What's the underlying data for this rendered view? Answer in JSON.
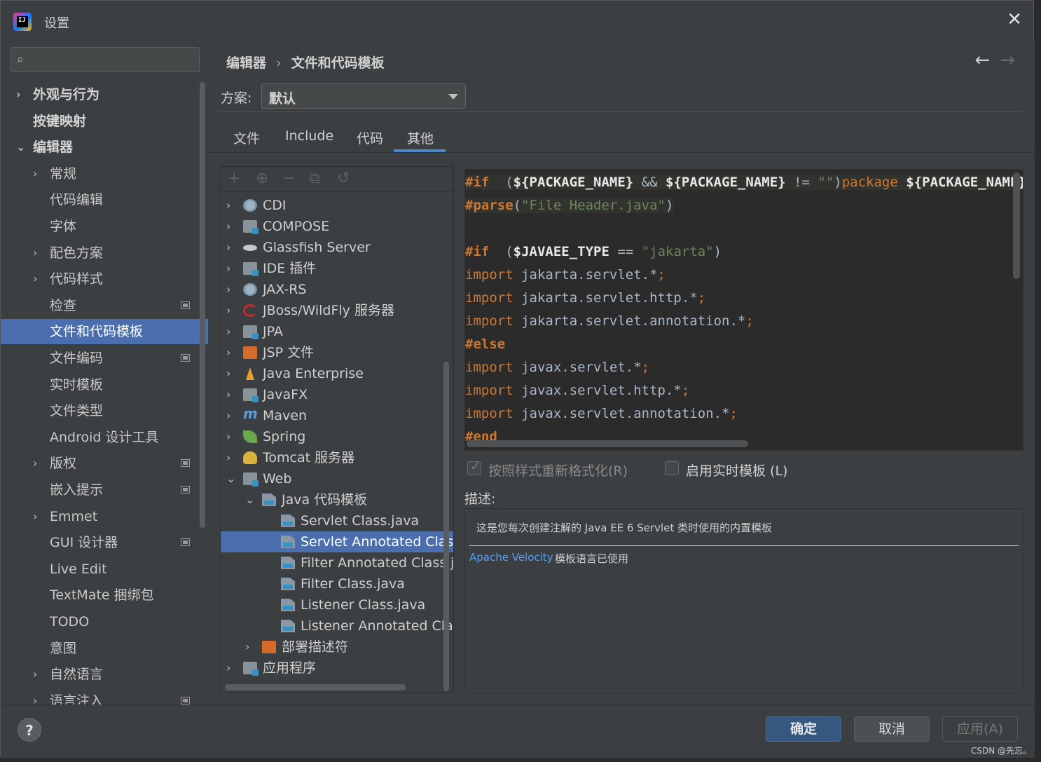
{
  "window": {
    "title": "设置",
    "app_icon": "intellij-icon",
    "close": "✕"
  },
  "search": {
    "placeholder": ""
  },
  "sidebar": {
    "items": [
      {
        "label": "外观与行为",
        "chevron": "›",
        "level": 0,
        "bold": true
      },
      {
        "label": "按键映射",
        "chevron": "",
        "level": 0,
        "bold": true
      },
      {
        "label": "编辑器",
        "chevron": "⌄",
        "level": 0,
        "bold": true
      },
      {
        "label": "常规",
        "chevron": "›",
        "level": 1
      },
      {
        "label": "代码编辑",
        "chevron": "",
        "level": 1
      },
      {
        "label": "字体",
        "chevron": "",
        "level": 1
      },
      {
        "label": "配色方案",
        "chevron": "›",
        "level": 1
      },
      {
        "label": "代码样式",
        "chevron": "›",
        "level": 1
      },
      {
        "label": "检查",
        "chevron": "",
        "level": 1,
        "project": true
      },
      {
        "label": "文件和代码模板",
        "chevron": "",
        "level": 1,
        "selected": true
      },
      {
        "label": "文件编码",
        "chevron": "",
        "level": 1,
        "project": true
      },
      {
        "label": "实时模板",
        "chevron": "",
        "level": 1
      },
      {
        "label": "文件类型",
        "chevron": "",
        "level": 1
      },
      {
        "label": "Android 设计工具",
        "chevron": "",
        "level": 1
      },
      {
        "label": "版权",
        "chevron": "›",
        "level": 1,
        "project": true
      },
      {
        "label": "嵌入提示",
        "chevron": "",
        "level": 1,
        "project": true
      },
      {
        "label": "Emmet",
        "chevron": "›",
        "level": 1
      },
      {
        "label": "GUI 设计器",
        "chevron": "",
        "level": 1,
        "project": true
      },
      {
        "label": "Live Edit",
        "chevron": "",
        "level": 1
      },
      {
        "label": "TextMate 捆绑包",
        "chevron": "",
        "level": 1
      },
      {
        "label": "TODO",
        "chevron": "",
        "level": 1
      },
      {
        "label": "意图",
        "chevron": "",
        "level": 1
      },
      {
        "label": "自然语言",
        "chevron": "›",
        "level": 1
      },
      {
        "label": "语言注入",
        "chevron": "›",
        "level": 1,
        "project": true
      }
    ]
  },
  "breadcrumb": {
    "parent": "编辑器",
    "separator": "›",
    "current": "文件和代码模板"
  },
  "nav": {
    "back": "←",
    "forward": "→"
  },
  "scheme": {
    "label": "方案:",
    "value": "默认"
  },
  "tabs": [
    {
      "label": "文件"
    },
    {
      "label": "Include"
    },
    {
      "label": "代码"
    },
    {
      "label": "其他",
      "active": true
    }
  ],
  "tree_toolbar": {
    "add": "+",
    "add_child": "⊕",
    "remove": "−",
    "copy": "⧉",
    "reset": "↺"
  },
  "tree": [
    {
      "label": "CDI",
      "chevron": "›",
      "level": 0,
      "icon": "cdi-icon",
      "icon_class": "globe"
    },
    {
      "label": "COMPOSE",
      "chevron": "›",
      "level": 0,
      "icon": "folder-icon",
      "icon_class": "folder"
    },
    {
      "label": "Glassfish Server",
      "chevron": "›",
      "level": 0,
      "icon": "glassfish-icon",
      "icon_class": "fish"
    },
    {
      "label": "IDE 插件",
      "chevron": "›",
      "level": 0,
      "icon": "plugin-icon",
      "icon_class": "folder"
    },
    {
      "label": "JAX-RS",
      "chevron": "›",
      "level": 0,
      "icon": "globe-icon",
      "icon_class": "globe"
    },
    {
      "label": "JBoss/WildFly 服务器",
      "chevron": "›",
      "level": 0,
      "icon": "jboss-icon",
      "icon_class": "red"
    },
    {
      "label": "JPA",
      "chevron": "›",
      "level": 0,
      "icon": "jpa-icon",
      "icon_class": "folder"
    },
    {
      "label": "JSP 文件",
      "chevron": "›",
      "level": 0,
      "icon": "jsp-icon",
      "icon_class": "jsp"
    },
    {
      "label": "Java Enterprise",
      "chevron": "›",
      "level": 0,
      "icon": "java-ee-icon",
      "icon_class": "orange"
    },
    {
      "label": "JavaFX",
      "chevron": "›",
      "level": 0,
      "icon": "folder-icon",
      "icon_class": "folder"
    },
    {
      "label": "Maven",
      "chevron": "›",
      "level": 0,
      "icon": "maven-icon",
      "icon_class": "m"
    },
    {
      "label": "Spring",
      "chevron": "›",
      "level": 0,
      "icon": "spring-leaf-icon",
      "icon_class": "leaf"
    },
    {
      "label": "Tomcat 服务器",
      "chevron": "›",
      "level": 0,
      "icon": "tomcat-icon",
      "icon_class": "cat"
    },
    {
      "label": "Web",
      "chevron": "⌄",
      "level": 0,
      "icon": "web-icon",
      "icon_class": "folder"
    },
    {
      "label": "Java 代码模板",
      "chevron": "⌄",
      "level": 1,
      "icon": "file-template-icon",
      "icon_class": "file"
    },
    {
      "label": "Servlet Class.java",
      "chevron": "",
      "level": 2,
      "icon": "file-template-icon",
      "icon_class": "file"
    },
    {
      "label": "Servlet Annotated Class.java",
      "chevron": "",
      "level": 2,
      "icon": "file-template-icon",
      "icon_class": "file",
      "selected": true
    },
    {
      "label": "Filter Annotated Class.java",
      "chevron": "",
      "level": 2,
      "icon": "file-template-icon",
      "icon_class": "file"
    },
    {
      "label": "Filter Class.java",
      "chevron": "",
      "level": 2,
      "icon": "file-template-icon",
      "icon_class": "file"
    },
    {
      "label": "Listener Class.java",
      "chevron": "",
      "level": 2,
      "icon": "file-template-icon",
      "icon_class": "file"
    },
    {
      "label": "Listener Annotated Class.java",
      "chevron": "",
      "level": 2,
      "icon": "file-template-icon",
      "icon_class": "file"
    },
    {
      "label": "部署描述符",
      "chevron": "›",
      "level": 1,
      "icon": "deployment-icon",
      "icon_class": "jsp"
    },
    {
      "label": "应用程序",
      "chevron": "›",
      "level": 0,
      "icon": "application-icon",
      "icon_class": "folder"
    }
  ],
  "code": [
    [
      [
        "dir",
        "#if"
      ],
      [
        "",
        "  ("
      ],
      [
        "var",
        "${PACKAGE_NAME}"
      ],
      [
        "",
        " && "
      ],
      [
        "var",
        "${PACKAGE_NAME}"
      ],
      [
        "",
        " != "
      ],
      [
        "str",
        "\"\""
      ],
      [
        "",
        ")"
      ],
      [
        "kw",
        "package"
      ],
      [
        "",
        " "
      ],
      [
        "var",
        "${PACKAGE_NAME}"
      ]
    ],
    [
      [
        "dir",
        "#parse"
      ],
      [
        "",
        "("
      ],
      [
        "str",
        "\"File Header.java\""
      ],
      [
        "",
        ")"
      ]
    ],
    [],
    [
      [
        "dir",
        "#if"
      ],
      [
        "",
        "  ("
      ],
      [
        "var",
        "$JAVAEE_TYPE"
      ],
      [
        "",
        " == "
      ],
      [
        "str",
        "\"jakarta\""
      ],
      [
        "",
        ")"
      ]
    ],
    [
      [
        "kw",
        "import"
      ],
      [
        "",
        " jakarta.servlet.*"
      ],
      [
        "kw",
        ";"
      ]
    ],
    [
      [
        "kw",
        "import"
      ],
      [
        "",
        " jakarta.servlet.http.*"
      ],
      [
        "kw",
        ";"
      ]
    ],
    [
      [
        "kw",
        "import"
      ],
      [
        "",
        " jakarta.servlet.annotation.*"
      ],
      [
        "kw",
        ";"
      ]
    ],
    [
      [
        "dir",
        "#else"
      ]
    ],
    [
      [
        "kw",
        "import"
      ],
      [
        "",
        " javax.servlet.*"
      ],
      [
        "kw",
        ";"
      ]
    ],
    [
      [
        "kw",
        "import"
      ],
      [
        "",
        " javax.servlet.http.*"
      ],
      [
        "kw",
        ";"
      ]
    ],
    [
      [
        "kw",
        "import"
      ],
      [
        "",
        " javax.servlet.annotation.*"
      ],
      [
        "kw",
        ";"
      ]
    ],
    [
      [
        "dir",
        "#end"
      ]
    ]
  ],
  "options": {
    "reformat": {
      "label": "按照样式重新格式化(R)",
      "checked": true,
      "disabled": true,
      "mark": "✓"
    },
    "live_template": {
      "label": "启用实时模板 (L)",
      "checked": false
    }
  },
  "description": {
    "label": "描述:",
    "text": "这是您每次创建注解的 Java EE 6 Servlet 类时使用的内置模板",
    "link": "Apache Velocity",
    "link_suffix": "模板语言已使用"
  },
  "footer": {
    "help": "?",
    "ok": "确定",
    "cancel": "取消",
    "apply": "应用(A)"
  },
  "watermark": "CSDN @先忘。",
  "colors": {
    "selection": "#4b6eaf",
    "accent": "#4a88c7",
    "primary_button": "#365880",
    "annotation_red": "#e02020"
  }
}
